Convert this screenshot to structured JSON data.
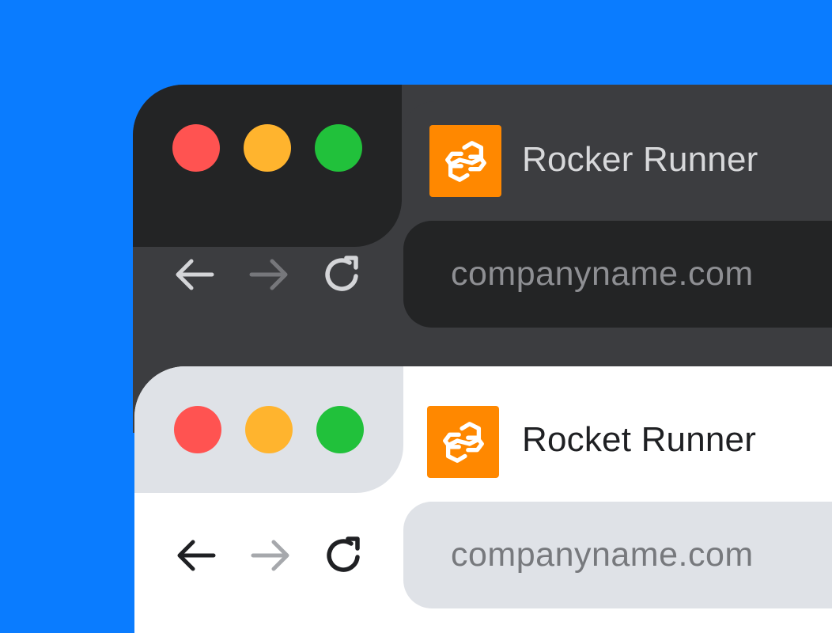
{
  "colors": {
    "background": "#0A7CFF",
    "traffic_close": "#FF5351",
    "traffic_minimize": "#FFB42E",
    "traffic_maximize": "#21C13B",
    "logo": "#FF8800",
    "dark_chrome": "#232425",
    "dark_panel": "#3C3D40",
    "light_chrome": "#DFE2E7",
    "light_panel": "#FFFFFF"
  },
  "dark_window": {
    "tab": {
      "title": "Rocker Runner",
      "icon": "rocket-runner-logo-icon"
    },
    "address_bar": {
      "url": "companyname.com"
    },
    "nav": {
      "back_icon": "arrow-left-icon",
      "forward_icon": "arrow-right-icon",
      "reload_icon": "reload-icon"
    }
  },
  "light_window": {
    "tab": {
      "title": "Rocket Runner",
      "icon": "rocket-runner-logo-icon"
    },
    "address_bar": {
      "url": "companyname.com"
    },
    "nav": {
      "back_icon": "arrow-left-icon",
      "forward_icon": "arrow-right-icon",
      "reload_icon": "reload-icon"
    }
  }
}
